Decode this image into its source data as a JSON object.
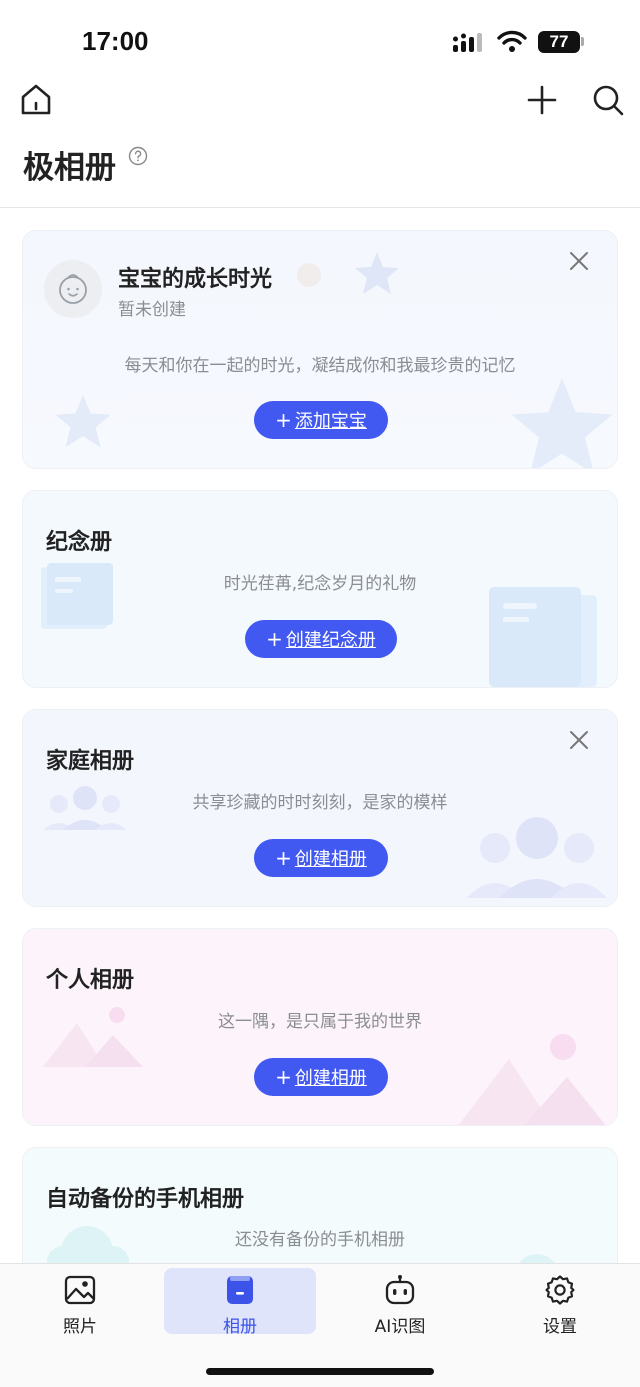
{
  "status_bar": {
    "time": "17:00",
    "battery": "77"
  },
  "page": {
    "title": "极相册"
  },
  "baby_card": {
    "title": "宝宝的成长时光",
    "subtitle": "暂未创建",
    "description": "每天和你在一起的时光，凝结成你和我最珍贵的记忆",
    "button_label": "添加宝宝"
  },
  "memorial_card": {
    "title": "纪念册",
    "description": "时光荏苒,纪念岁月的礼物",
    "button_label": "创建纪念册"
  },
  "family_card": {
    "title": "家庭相册",
    "description": "共享珍藏的时时刻刻，是家的模样",
    "button_label": "创建相册"
  },
  "personal_card": {
    "title": "个人相册",
    "description": "这一隅，是只属于我的世界",
    "button_label": "创建相册"
  },
  "backup_card": {
    "title": "自动备份的手机相册",
    "description": "还没有备份的手机相册"
  },
  "tabs": [
    {
      "label": "照片",
      "icon": "photo-icon"
    },
    {
      "label": "相册",
      "icon": "album-icon",
      "active": true
    },
    {
      "label": "AI识图",
      "icon": "robot-icon"
    },
    {
      "label": "设置",
      "icon": "gear-icon"
    }
  ],
  "colors": {
    "accent": "#4159f0",
    "active_tab_bg": "#dfe4fb",
    "muted_text": "#8a8d92"
  }
}
